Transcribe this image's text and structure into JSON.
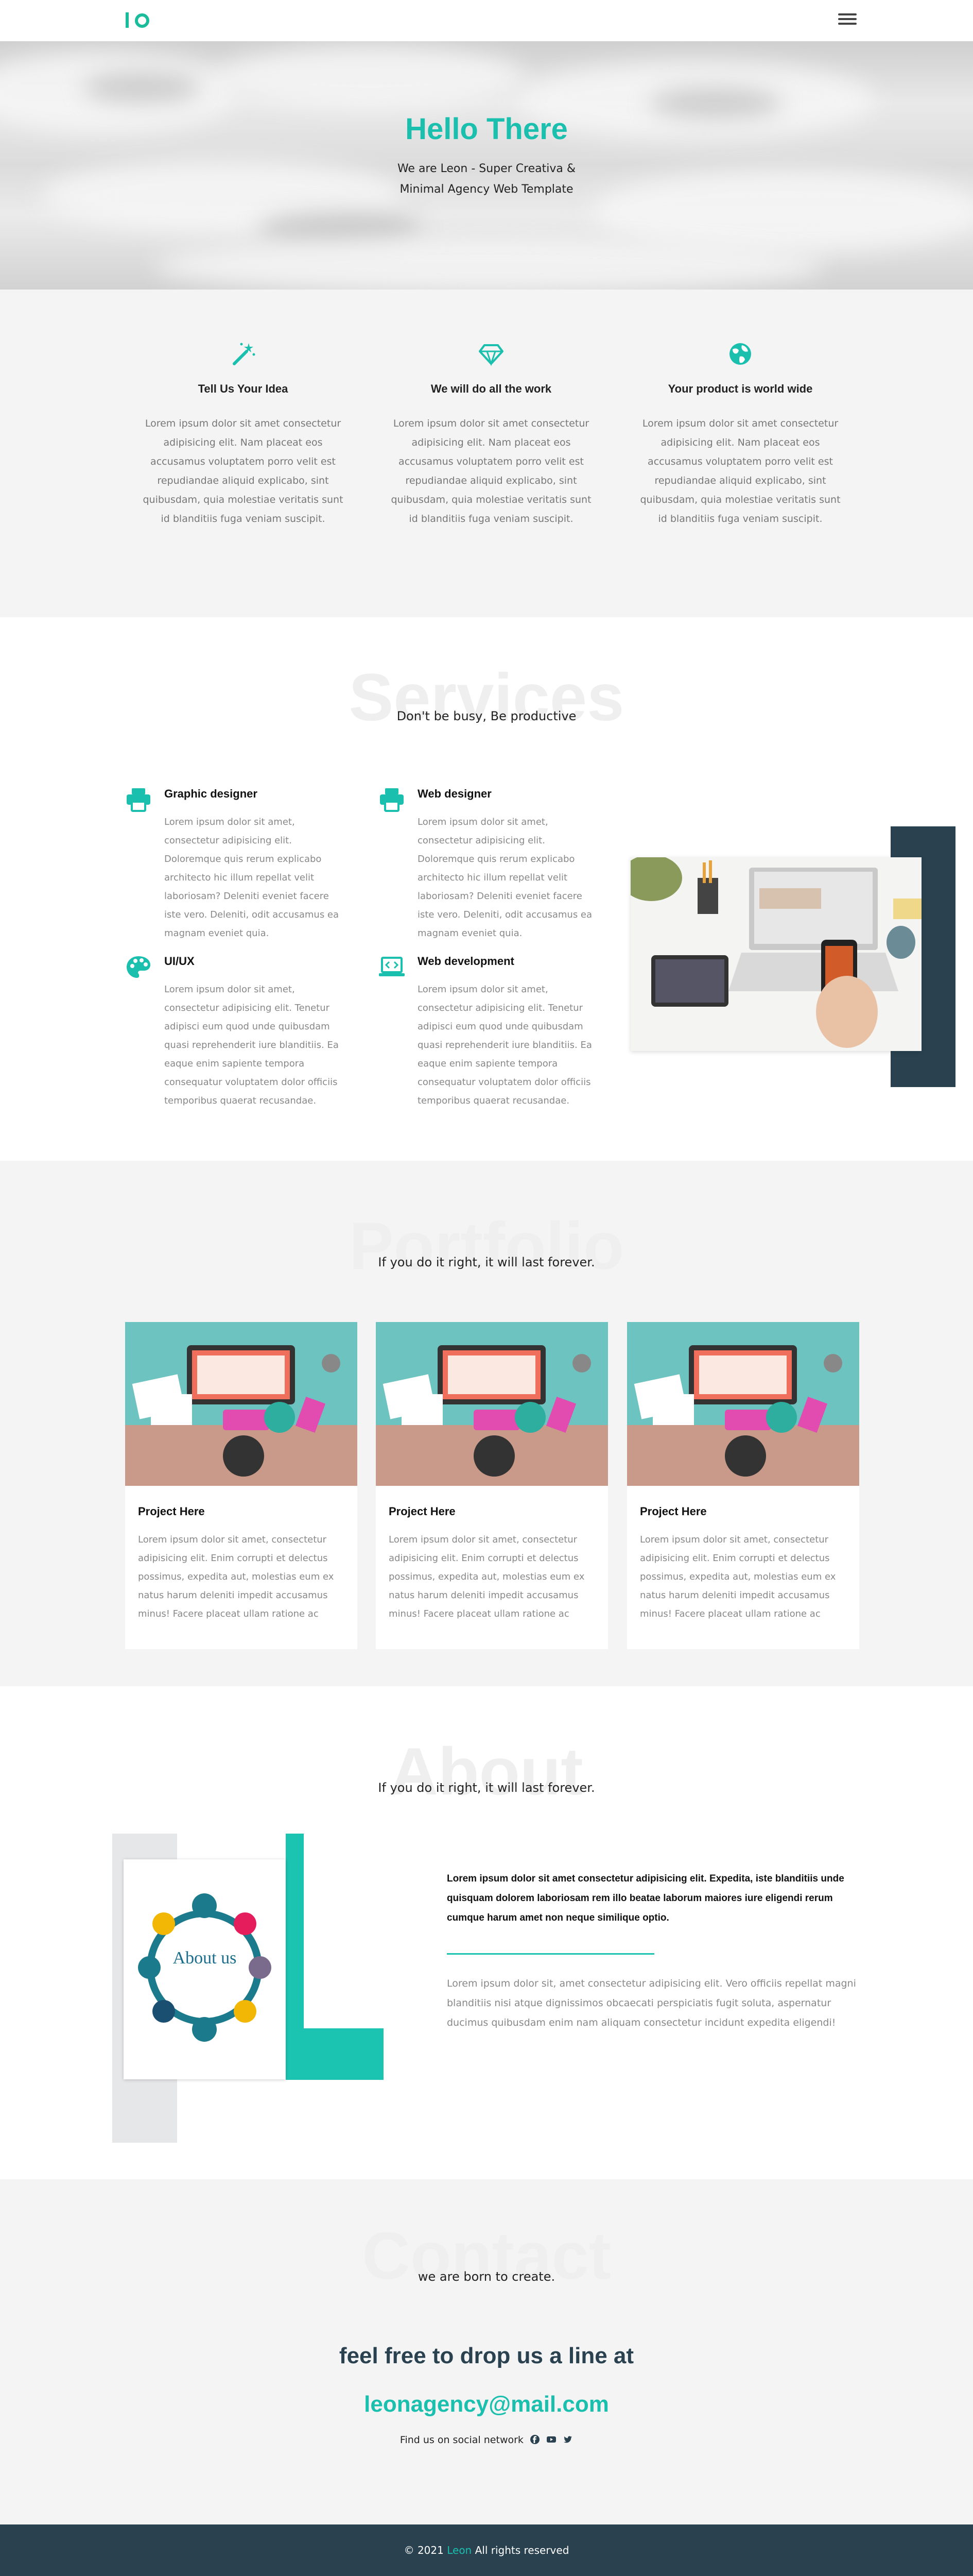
{
  "header": {
    "menu_icon": "hamburger-menu-icon"
  },
  "hero": {
    "title": "Hello There",
    "subtitle": "We are Leon - Super Creativa & Minimal Agency Web Template"
  },
  "features": [
    {
      "icon": "magic-wand-icon",
      "title": "Tell Us Your Idea",
      "text": "Lorem ipsum dolor sit amet consectetur adipisicing elit. Nam placeat eos accusamus voluptatem porro velit est repudiandae aliquid explicabo, sint quibusdam, quia molestiae veritatis sunt id blanditiis fuga veniam suscipit."
    },
    {
      "icon": "diamond-icon",
      "title": "We will do all the work",
      "text": "Lorem ipsum dolor sit amet consectetur adipisicing elit. Nam placeat eos accusamus voluptatem porro velit est repudiandae aliquid explicabo, sint quibusdam, quia molestiae veritatis sunt id blanditiis fuga veniam suscipit."
    },
    {
      "icon": "globe-icon",
      "title": "Your product is world wide",
      "text": "Lorem ipsum dolor sit amet consectetur adipisicing elit. Nam placeat eos accusamus voluptatem porro velit est repudiandae aliquid explicabo, sint quibusdam, quia molestiae veritatis sunt id blanditiis fuga veniam suscipit."
    }
  ],
  "services": {
    "heading": "Services",
    "subheading": "Don't be busy, Be productive",
    "items": [
      {
        "icon": "printer-icon",
        "title": "Graphic designer",
        "text": "Lorem ipsum dolor sit amet, consectetur adipisicing elit. Doloremque quis rerum explicabo architecto hic illum repellat velit laboriosam? Deleniti eveniet facere iste vero. Deleniti, odit accusamus ea magnam eveniet quia."
      },
      {
        "icon": "printer-icon",
        "title": "Web designer",
        "text": "Lorem ipsum dolor sit amet, consectetur adipisicing elit. Doloremque quis rerum explicabo architecto hic illum repellat velit laboriosam? Deleniti eveniet facere iste vero. Deleniti, odit accusamus ea magnam eveniet quia."
      },
      {
        "icon": "palette-icon",
        "title": "UI/UX",
        "text": "Lorem ipsum dolor sit amet, consectetur adipisicing elit. Tenetur adipisci eum quod unde quibusdam quasi reprehenderit iure blanditiis. Ea eaque enim sapiente tempora consequatur voluptatem dolor officiis temporibus quaerat recusandae."
      },
      {
        "icon": "code-laptop-icon",
        "title": "Web development",
        "text": "Lorem ipsum dolor sit amet, consectetur adipisicing elit. Tenetur adipisci eum quod unde quibusdam quasi reprehenderit iure blanditiis. Ea eaque enim sapiente tempora consequatur voluptatem dolor officiis temporibus quaerat recusandae."
      }
    ]
  },
  "portfolio": {
    "heading": "Portfolio",
    "subheading": "If you do it right, it will last forever.",
    "items": [
      {
        "title": "Project Here",
        "text": "Lorem ipsum dolor sit amet, consectetur adipisicing elit. Enim corrupti et delectus possimus, expedita aut, molestias eum ex natus harum deleniti impedit accusamus minus! Facere placeat ullam ratione ac"
      },
      {
        "title": "Project Here",
        "text": "Lorem ipsum dolor sit amet, consectetur adipisicing elit. Enim corrupti et delectus possimus, expedita aut, molestias eum ex natus harum deleniti impedit accusamus minus! Facere placeat ullam ratione ac"
      },
      {
        "title": "Project Here",
        "text": "Lorem ipsum dolor sit amet, consectetur adipisicing elit. Enim corrupti et delectus possimus, expedita aut, molestias eum ex natus harum deleniti impedit accusamus minus! Facere placeat ullam ratione ac"
      }
    ]
  },
  "about": {
    "heading": "About",
    "subheading": "If you do it right, it will last forever.",
    "image_text": "About us",
    "lead": "Lorem ipsum dolor sit amet consectetur adipisicing elit. Expedita, iste blanditiis unde quisquam dolorem laboriosam rem illo beatae laborum maiores iure eligendi rerum cumque harum amet non neque similique optio.",
    "text": "Lorem ipsum dolor sit, amet consectetur adipisicing elit. Vero officiis repellat magni blanditiis nisi atque dignissimos obcaecati perspiciatis fugit soluta, aspernatur ducimus quibusdam enim nam aliquam consectetur incidunt expedita eligendi!"
  },
  "contact": {
    "heading": "Contact",
    "subheading": "we are born to create.",
    "line": "feel free to drop us a line at",
    "email": "leonagency@mail.com",
    "social_label": "Find us on social network",
    "social_icons": [
      "facebook-icon",
      "youtube-icon",
      "twitter-icon"
    ]
  },
  "footer": {
    "prefix": "© 2021",
    "brand": "Leon",
    "suffix": "All rights reserved"
  },
  "colors": {
    "accent": "#1abfae",
    "dark": "#2a4250",
    "section_grey": "#f4f4f4"
  }
}
